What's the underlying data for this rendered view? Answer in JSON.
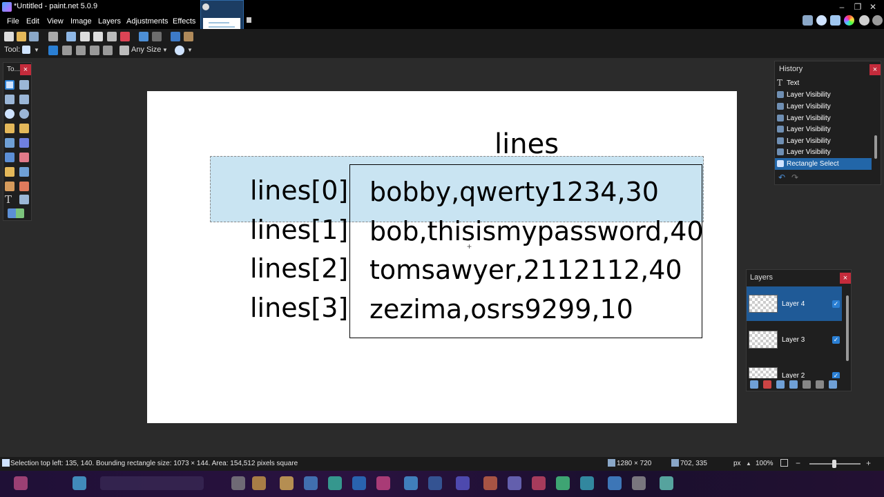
{
  "window": {
    "title": "*Untitled - paint.net 5.0.9",
    "controls": {
      "minimize": "–",
      "restore": "❐",
      "close": "✕"
    }
  },
  "menu": [
    "File",
    "Edit",
    "View",
    "Image",
    "Layers",
    "Adjustments",
    "Effects"
  ],
  "toolbar": {
    "tool_label": "Tool:",
    "brush_size": "Any Size"
  },
  "tools_panel": {
    "title": "To...",
    "close": "×"
  },
  "canvas": {
    "title": "lines",
    "labels": [
      "lines[0]",
      "lines[1]",
      "lines[2]",
      "lines[3]"
    ],
    "rows": [
      "bobby,qwerty1234,30",
      "bob,thisismypassword,40",
      "tomsawyer,2112112,40",
      "zezima,osrs9299,10"
    ],
    "selection_color": "#87c4e2"
  },
  "history": {
    "title": "History",
    "close": "×",
    "items": [
      "Text",
      "Layer Visibility",
      "Layer Visibility",
      "Layer Visibility",
      "Layer Visibility",
      "Layer Visibility",
      "Layer Visibility",
      "Rectangle Select"
    ]
  },
  "layers": {
    "title": "Layers",
    "close": "×",
    "items": [
      {
        "name": "Layer 4",
        "visible": "✓"
      },
      {
        "name": "Layer 3",
        "visible": "✓"
      },
      {
        "name": "Layer 2",
        "visible": "✓"
      }
    ]
  },
  "status": {
    "selection": "Selection top left: 135, 140. Bounding rectangle size: 1073 × 144. Area: 154,512 pixels square",
    "image_size": "1280 × 720",
    "cursor": "702, 335",
    "units": "px",
    "zoom": "100%"
  },
  "colors": {
    "accent": "#2266a8",
    "close": "#c42b3b",
    "canvas_bg": "#2b2b2b"
  }
}
